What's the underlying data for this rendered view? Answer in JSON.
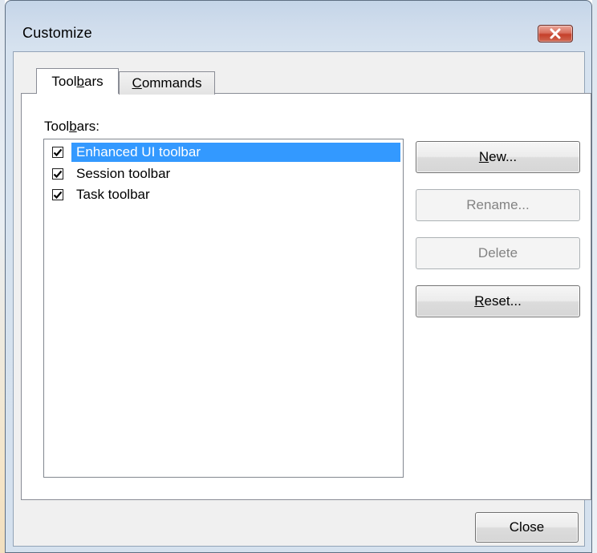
{
  "window": {
    "title": "Customize"
  },
  "tabs": [
    {
      "label_pre": "Tool",
      "label_key": "b",
      "label_post": "ars"
    },
    {
      "label_pre": "",
      "label_key": "C",
      "label_post": "ommands"
    }
  ],
  "toolbars_panel": {
    "list_label_pre": "Tool",
    "list_label_key": "b",
    "list_label_post": "ars:",
    "items": [
      {
        "label": "Enhanced UI toolbar",
        "checked": true,
        "selected": true
      },
      {
        "label": "Session toolbar",
        "checked": true,
        "selected": false
      },
      {
        "label": "Task toolbar",
        "checked": true,
        "selected": false
      }
    ]
  },
  "buttons": {
    "new": {
      "key": "N",
      "rest": "ew...",
      "enabled": true
    },
    "rename": {
      "label": "Rename...",
      "enabled": false
    },
    "delete": {
      "label": "Delete",
      "enabled": false
    },
    "reset": {
      "key": "R",
      "rest": "eset...",
      "enabled": true
    },
    "close": {
      "label": "Close",
      "enabled": true
    }
  },
  "icons": {
    "close": "close-x-icon",
    "check": "checkmark-icon"
  },
  "colors": {
    "selection": "#3399ff",
    "close_button": "#c5402b",
    "disabled_text": "#838383"
  }
}
